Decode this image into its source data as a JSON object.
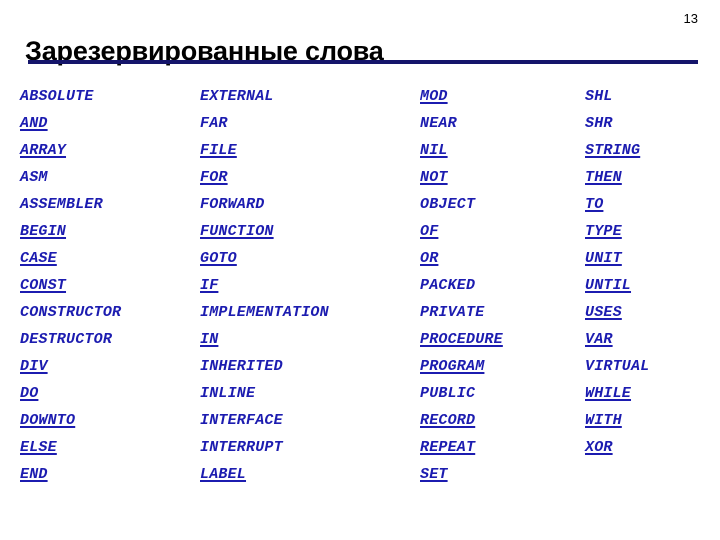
{
  "slide": {
    "title": "Зарезервированные слова",
    "number": "13",
    "accent_color": "#15156b",
    "keyword_color": "#1c1cb0",
    "background_color": "#ffffff"
  },
  "columns": [
    {
      "index": 0,
      "keywords": [
        {
          "text": "ABSOLUTE",
          "underlined": false
        },
        {
          "text": "AND",
          "underlined": true
        },
        {
          "text": "ARRAY",
          "underlined": true
        },
        {
          "text": "ASM",
          "underlined": false
        },
        {
          "text": "ASSEMBLER",
          "underlined": false
        },
        {
          "text": "BEGIN",
          "underlined": true
        },
        {
          "text": "CASE",
          "underlined": true
        },
        {
          "text": "CONST",
          "underlined": true
        },
        {
          "text": "CONSTRUCTOR",
          "underlined": false
        },
        {
          "text": "DESTRUCTOR",
          "underlined": false
        },
        {
          "text": "DIV",
          "underlined": true
        },
        {
          "text": "DO",
          "underlined": true
        },
        {
          "text": "DOWNTO",
          "underlined": true
        },
        {
          "text": "ELSE",
          "underlined": true
        },
        {
          "text": "END",
          "underlined": true
        }
      ]
    },
    {
      "index": 1,
      "keywords": [
        {
          "text": "EXTERNAL",
          "underlined": false
        },
        {
          "text": "FAR",
          "underlined": false
        },
        {
          "text": "FILE",
          "underlined": true
        },
        {
          "text": "FOR",
          "underlined": true
        },
        {
          "text": "FORWARD",
          "underlined": false
        },
        {
          "text": "FUNCTION",
          "underlined": true
        },
        {
          "text": "GOTO",
          "underlined": true
        },
        {
          "text": "IF",
          "underlined": true
        },
        {
          "text": "IMPLEMENTATION",
          "underlined": false
        },
        {
          "text": "IN",
          "underlined": true
        },
        {
          "text": "INHERITED",
          "underlined": false
        },
        {
          "text": "INLINE",
          "underlined": false
        },
        {
          "text": "INTERFACE",
          "underlined": false
        },
        {
          "text": "INTERRUPT",
          "underlined": false
        },
        {
          "text": "LABEL",
          "underlined": true
        }
      ]
    },
    {
      "index": 2,
      "keywords": [
        {
          "text": "MOD",
          "underlined": true
        },
        {
          "text": "NEAR",
          "underlined": false
        },
        {
          "text": "NIL",
          "underlined": true
        },
        {
          "text": "NOT",
          "underlined": true
        },
        {
          "text": "OBJECT",
          "underlined": false
        },
        {
          "text": "OF",
          "underlined": true
        },
        {
          "text": "OR",
          "underlined": true
        },
        {
          "text": "PACKED",
          "underlined": false
        },
        {
          "text": "PRIVATE",
          "underlined": false
        },
        {
          "text": "PROCEDURE",
          "underlined": true
        },
        {
          "text": "PROGRAM",
          "underlined": true
        },
        {
          "text": "PUBLIC",
          "underlined": false
        },
        {
          "text": "RECORD",
          "underlined": true
        },
        {
          "text": "REPEAT",
          "underlined": true
        },
        {
          "text": "SET",
          "underlined": true
        }
      ]
    },
    {
      "index": 3,
      "keywords": [
        {
          "text": "SHL",
          "underlined": false
        },
        {
          "text": "SHR",
          "underlined": false
        },
        {
          "text": "STRING",
          "underlined": true
        },
        {
          "text": "THEN",
          "underlined": true
        },
        {
          "text": "TO",
          "underlined": true
        },
        {
          "text": "TYPE",
          "underlined": true
        },
        {
          "text": "UNIT",
          "underlined": true
        },
        {
          "text": "UNTIL",
          "underlined": true
        },
        {
          "text": "USES",
          "underlined": true
        },
        {
          "text": "VAR",
          "underlined": true
        },
        {
          "text": "VIRTUAL",
          "underlined": false
        },
        {
          "text": "WHILE",
          "underlined": true
        },
        {
          "text": "WITH",
          "underlined": true
        },
        {
          "text": "XOR",
          "underlined": true
        }
      ]
    }
  ]
}
